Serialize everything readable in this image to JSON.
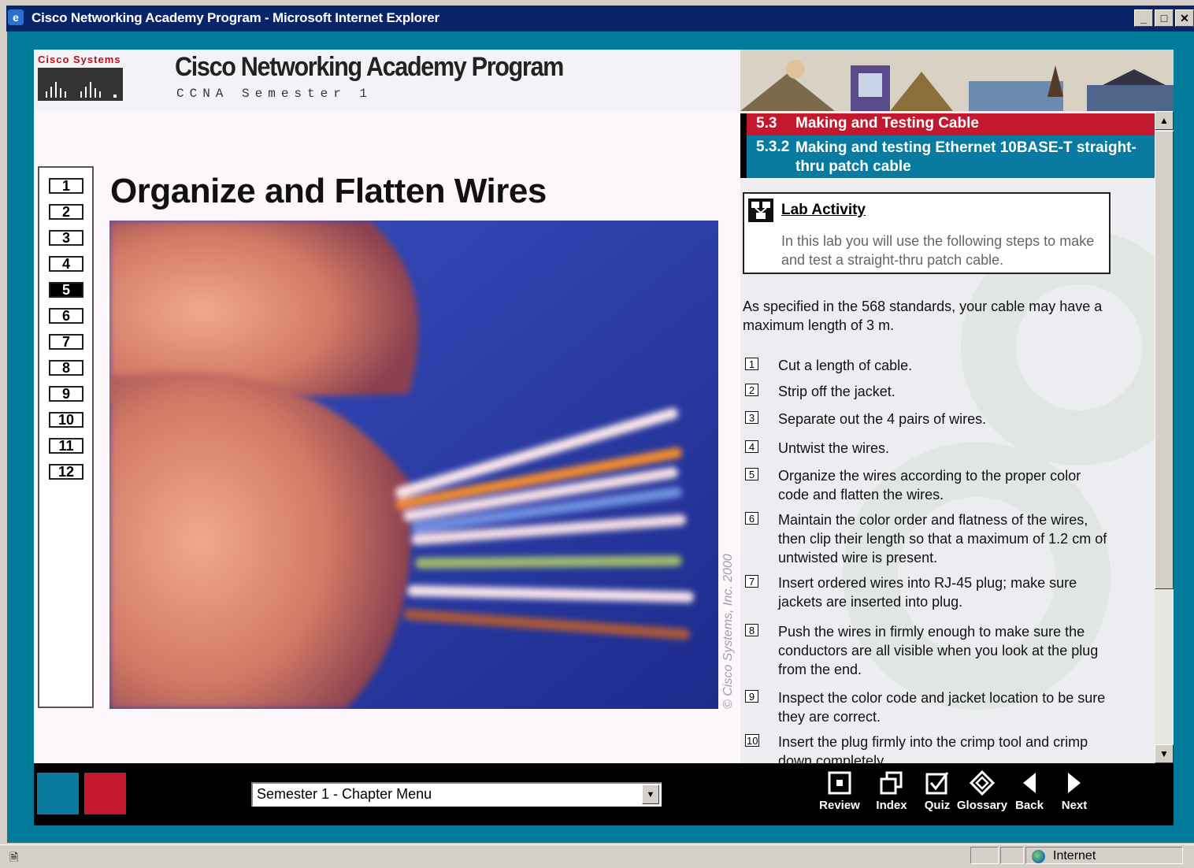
{
  "window": {
    "title": "Cisco Networking Academy Program - Microsoft Internet Explorer",
    "buttons": [
      "_",
      "□",
      "✕"
    ]
  },
  "header": {
    "logo_text": "Cisco Systems",
    "app_title": "Cisco Networking Academy Program",
    "app_subtitle": "CCNA Semester 1"
  },
  "steps_nav": [
    "1",
    "2",
    "3",
    "4",
    "5",
    "6",
    "7",
    "8",
    "9",
    "10",
    "11",
    "12"
  ],
  "active_step": "5",
  "page_heading": "Organize and Flatten Wires",
  "photo_credit": "© Cisco Systems, Inc. 2000",
  "section": {
    "number": "5.3",
    "title": "Making and Testing Cable",
    "sub_number": "5.3.2",
    "sub_title": "Making and testing Ethernet 10BASE-T straight-thru patch cable"
  },
  "lab": {
    "title": "Lab Activity",
    "description": "In this lab you will use the following steps to make and test a straight-thru patch cable."
  },
  "intro_text": "As specified in the 568 standards, your cable may have a maximum length of 3 m.",
  "procedure": [
    {
      "no": "1",
      "text": "Cut a length of cable."
    },
    {
      "no": "2",
      "text": "Strip off the jacket."
    },
    {
      "no": "3",
      "text": "Separate out the 4 pairs of wires."
    },
    {
      "no": "4",
      "text": "Untwist the wires."
    },
    {
      "no": "5",
      "text": "Organize the wires according to the proper color code and flatten the wires."
    },
    {
      "no": "6",
      "text": "Maintain the color order and flatness of the wires, then clip their length so that a maximum of 1.2 cm of untwisted wire is present."
    },
    {
      "no": "7",
      "text": "Insert ordered wires into RJ-45 plug; make sure jackets are inserted into plug."
    },
    {
      "no": "8",
      "text": "Push the wires in firmly enough to make sure the conductors are all visible when you look at the plug from the end."
    },
    {
      "no": "9",
      "text": "Inspect the color code and jacket location to be sure they are correct."
    },
    {
      "no": "10",
      "text": "Insert the plug firmly into the crimp tool and crimp down completely."
    }
  ],
  "footer": {
    "chapter_menu": "Semester 1 - Chapter Menu",
    "nav": [
      "Review",
      "Index",
      "Quiz",
      "Glossary",
      "Back",
      "Next"
    ],
    "icons": [
      "review-icon",
      "index-icon",
      "quiz-icon",
      "glossary-icon",
      "back-icon",
      "next-icon"
    ]
  },
  "statusbar": {
    "zone": "Internet"
  },
  "colors": {
    "teal": "#007c9a",
    "red": "#c4182e",
    "section_teal": "#0a7ba0",
    "title_bar": "#0a246a"
  }
}
